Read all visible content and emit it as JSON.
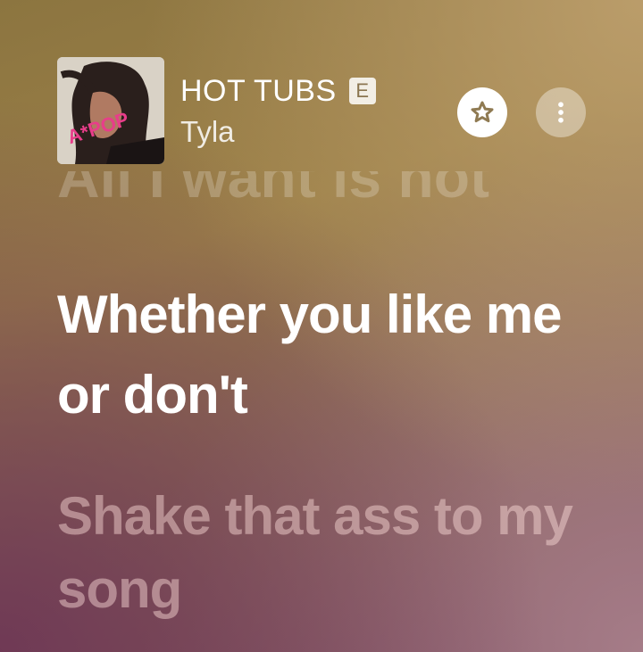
{
  "now_playing": {
    "title": "HOT TUBS",
    "explicit_badge": "E",
    "artist": "Tyla",
    "album_art_text": "A*POP"
  },
  "actions": {
    "favorite_icon": "star-icon",
    "more_icon": "more-vertical-icon"
  },
  "lyrics": {
    "previous_line": "All I want is not",
    "current_line": "Whether you like me or don't",
    "next_line": "Shake that ass to my song"
  },
  "colors": {
    "background_top": "#9c8048",
    "background_bottom": "#7c4a62",
    "explicit_badge_text": "#8a7550"
  }
}
